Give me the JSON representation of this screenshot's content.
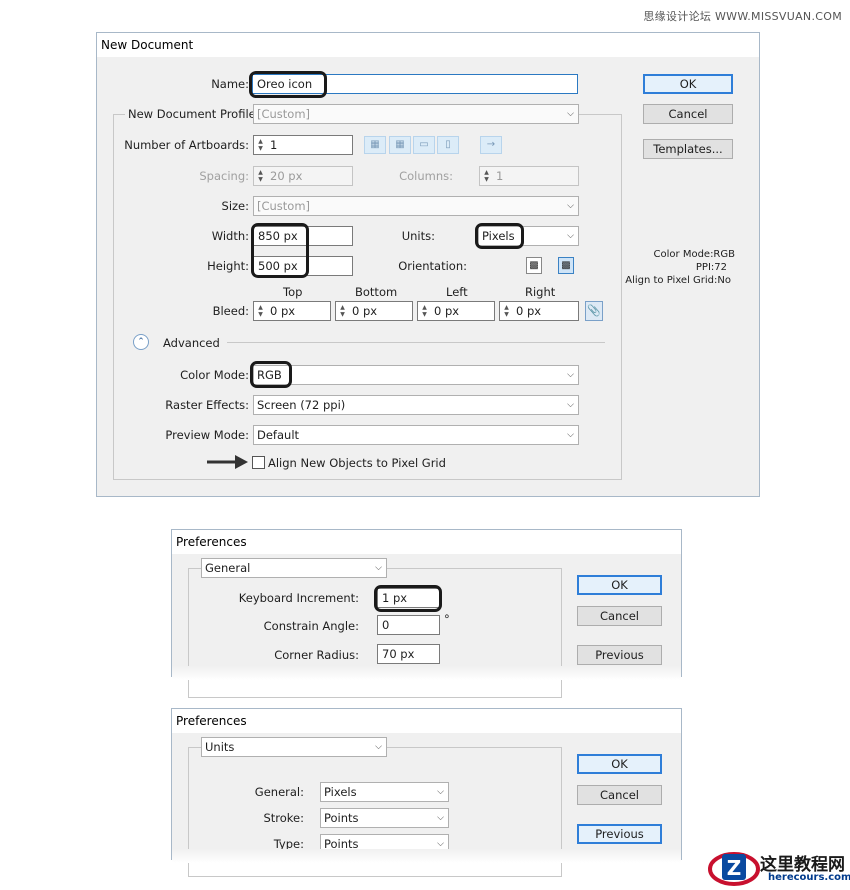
{
  "watermark": "思缘设计论坛 WWW.MISSVUAN.COM",
  "new_document": {
    "title": "New Document",
    "name_label": "Name:",
    "name_value": "Oreo icon",
    "profile_label": "New Document Profile:",
    "profile_value": "[Custom]",
    "artboards_label": "Number of Artboards:",
    "artboards_value": "1",
    "artboard_arrow": "→",
    "spacing_label": "Spacing:",
    "spacing_value": "20 px",
    "columns_label": "Columns:",
    "columns_value": "1",
    "size_label": "Size:",
    "size_value": "[Custom]",
    "width_label": "Width:",
    "width_value": "850 px",
    "units_label": "Units:",
    "units_value": "Pixels",
    "height_label": "Height:",
    "height_value": "500 px",
    "orientation_label": "Orientation:",
    "bleed_label": "Bleed:",
    "bleed_top_label": "Top",
    "bleed_bottom_label": "Bottom",
    "bleed_left_label": "Left",
    "bleed_right_label": "Right",
    "bleed_top": "0 px",
    "bleed_bottom": "0 px",
    "bleed_left": "0 px",
    "bleed_right": "0 px",
    "advanced_label": "Advanced",
    "color_mode_label": "Color Mode:",
    "color_mode_value": "RGB",
    "raster_label": "Raster Effects:",
    "raster_value": "Screen (72 ppi)",
    "preview_label": "Preview Mode:",
    "preview_value": "Default",
    "align_label": "Align New Objects to Pixel Grid",
    "ok": "OK",
    "cancel": "Cancel",
    "templates": "Templates...",
    "info_color": "Color Mode:RGB",
    "info_ppi": "PPI:72",
    "info_align": "Align to Pixel Grid:No"
  },
  "prefs_general": {
    "title": "Preferences",
    "section": "General",
    "keyboard_label": "Keyboard Increment:",
    "keyboard_value": "1 px",
    "angle_label": "Constrain Angle:",
    "angle_value": "0",
    "degree": "°",
    "radius_label": "Corner Radius:",
    "radius_value": "70 px",
    "ok": "OK",
    "cancel": "Cancel",
    "previous": "Previous"
  },
  "prefs_units": {
    "title": "Preferences",
    "section": "Units",
    "general_label": "General:",
    "general_value": "Pixels",
    "stroke_label": "Stroke:",
    "stroke_value": "Points",
    "type_label": "Type:",
    "type_value": "Points",
    "ok": "OK",
    "cancel": "Cancel",
    "previous": "Previous"
  },
  "site_logo": {
    "name": "这里教程网",
    "url": "herecours.com"
  },
  "icons": [
    "chevron-down-icon",
    "spinner-icon",
    "artboard-grid-icon",
    "portrait-icon",
    "landscape-icon",
    "link-icon",
    "arrow-icon",
    "collapse-icon",
    "site-logo-icon"
  ]
}
